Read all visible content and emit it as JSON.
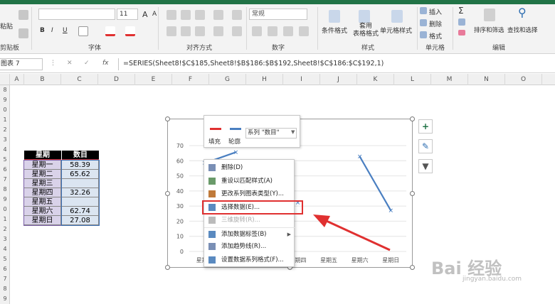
{
  "ribbon": {
    "groups": {
      "clipboard": "剪贴板",
      "font": "字体",
      "alignment": "对齐方式",
      "number": "数字",
      "styles": "样式",
      "cells": "单元格",
      "editing": "编辑"
    },
    "paste_label": "粘贴",
    "font_size": "11",
    "number_format": "常规",
    "buttons": {
      "conditional": "条件格式",
      "table_format": "套用\n表格格式",
      "cell_style": "单元格样式",
      "insert": "插入",
      "delete": "删除",
      "format": "格式",
      "sort_filter": "排序和筛选",
      "find_select": "查找和选择"
    },
    "font_controls": {
      "bold": "B",
      "italic": "I",
      "underline": "U",
      "grow": "A",
      "shrink": "A"
    }
  },
  "formula_bar": {
    "name_box": "图表 7",
    "cancel": "✕",
    "confirm": "✓",
    "fx": "fx",
    "formula": "=SERIES(Sheet8!$C$185,Sheet8!$B$186:$B$192,Sheet8!$C$186:$C$192,1)"
  },
  "columns": [
    "A",
    "B",
    "C",
    "D",
    "E",
    "F",
    "G",
    "H",
    "I",
    "J",
    "K",
    "L",
    "M",
    "N",
    "O"
  ],
  "rows": [
    "8",
    "9",
    "0",
    "1",
    "2",
    "3",
    "4",
    "5",
    "6",
    "7",
    "8",
    "9",
    "0",
    "1",
    "2",
    "3",
    "4",
    "5",
    "6",
    "7",
    "8",
    "9"
  ],
  "table": {
    "headers": [
      "星期",
      "数目"
    ],
    "rows": [
      [
        "星期一",
        "58.39"
      ],
      [
        "星期二",
        "65.62"
      ],
      [
        "星期三",
        ""
      ],
      [
        "星期四",
        "32.26"
      ],
      [
        "星期五",
        ""
      ],
      [
        "星期六",
        "62.74"
      ],
      [
        "星期日",
        "27.08"
      ]
    ]
  },
  "chart_data": {
    "type": "line",
    "categories": [
      "星期一",
      "星期二",
      "星期三",
      "星期四",
      "星期五",
      "星期六",
      "星期日"
    ],
    "series": [
      {
        "values": [
          58.39,
          65.62,
          null,
          32.26,
          null,
          62.74,
          27.08
        ]
      }
    ],
    "yticks": [
      "0",
      "10",
      "20",
      "30",
      "40",
      "50",
      "60",
      "70"
    ],
    "ylim": [
      0,
      70
    ],
    "color": "#4a7fc1"
  },
  "format_toolbar": {
    "fill": "填充",
    "outline": "轮廓",
    "series_select": "系列 \"数目\""
  },
  "context_menu": [
    {
      "label": "删除(D)",
      "enabled": true
    },
    {
      "label": "重设以匹配样式(A)",
      "enabled": true
    },
    {
      "label": "更改系列图表类型(Y)...",
      "enabled": true
    },
    {
      "label": "选择数据(E)...",
      "enabled": true,
      "highlight": true
    },
    {
      "label": "三维旋转(R)...",
      "enabled": false
    },
    {
      "label": "添加数据标签(B)",
      "enabled": true,
      "submenu": true
    },
    {
      "label": "添加趋势线(R)...",
      "enabled": true
    },
    {
      "label": "设置数据系列格式(F)...",
      "enabled": true
    }
  ],
  "side_buttons": [
    {
      "icon": "plus-icon",
      "glyph": "+"
    },
    {
      "icon": "brush-icon",
      "glyph": "✎"
    },
    {
      "icon": "filter-icon",
      "glyph": "▼"
    }
  ],
  "watermark": {
    "text": "Bai 经验",
    "url": "jingyan.baidu.com"
  },
  "colors": {
    "highlight": "#e03030",
    "arrow": "#e03030",
    "excel_green": "#217346"
  }
}
